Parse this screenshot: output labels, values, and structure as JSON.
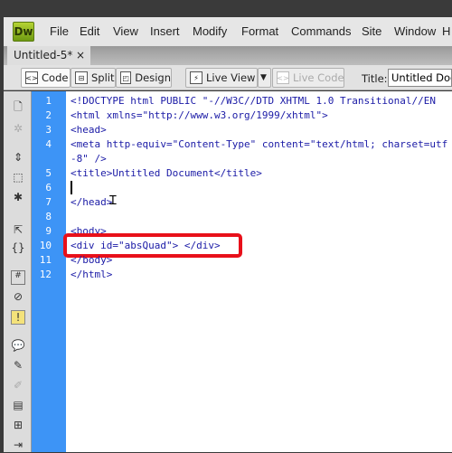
{
  "app": {
    "logo": "Dw",
    "menu": [
      "File",
      "Edit",
      "View",
      "Insert",
      "Modify",
      "Format",
      "Commands",
      "Site",
      "Window",
      "H"
    ]
  },
  "tab": {
    "name": "Untitled-5*",
    "close": "×"
  },
  "toolbar": {
    "code": "Code",
    "split": "Split",
    "design": "Design",
    "live_view": "Live View",
    "live_code": "Live Code",
    "title_label": "Title:",
    "title_value": "Untitled Document"
  },
  "line_numbers": [
    "1",
    "2",
    "3",
    "4",
    "5",
    "6",
    "7",
    "8",
    "9",
    "10",
    "11",
    "12"
  ],
  "code_lines": [
    "<!DOCTYPE html PUBLIC \"-//W3C//DTD XHTML 1.0 Transitional//EN",
    "<html xmlns=\"http://www.w3.org/1999/xhtml\">",
    "<head>",
    "<meta http-equiv=\"Content-Type\" content=\"text/html; charset=utf-8\" />",
    "<title>Untitled Document</title>",
    "",
    "</head>",
    "",
    "<body>",
    "<div id=\"absQuad\"> </div>",
    "</body>",
    "</html>"
  ],
  "colors": {
    "gutter": "#3d94f6",
    "highlight": "#e8101a",
    "code_text": "#1a1aa6"
  }
}
